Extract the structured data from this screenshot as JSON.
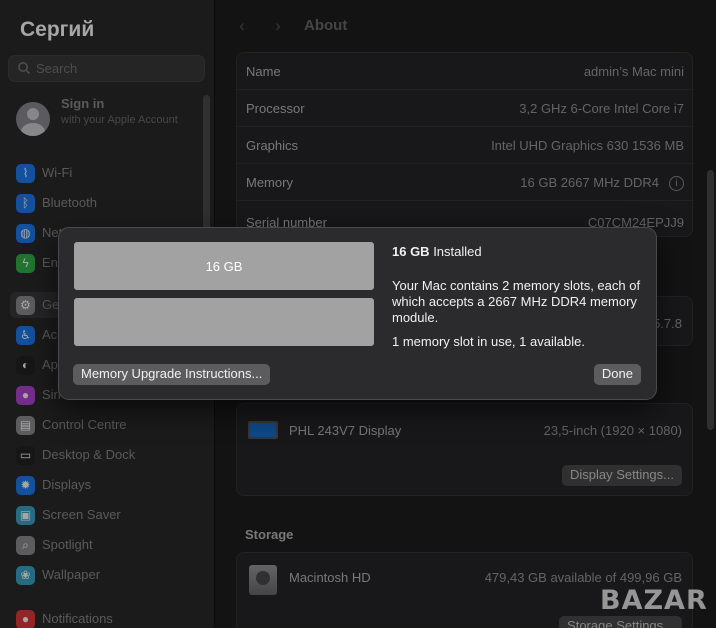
{
  "sidebar": {
    "user_title": "Сергий",
    "search_placeholder": "Search",
    "signin": {
      "name": "Sign in",
      "sub": "with your Apple Account"
    },
    "items": [
      {
        "label": "Wi-Fi",
        "icon": "wifi-icon",
        "color": "#1e7cf2",
        "glyph": "⌇"
      },
      {
        "label": "Bluetooth",
        "icon": "bluetooth-icon",
        "color": "#1e7cf2",
        "glyph": "ᛒ"
      },
      {
        "label": "Network",
        "icon": "network-icon",
        "color": "#1e7cf2",
        "glyph": "◍"
      },
      {
        "label": "Energy",
        "icon": "energy-icon",
        "color": "#33b24a",
        "glyph": "ϟ"
      },
      {
        "label": "General",
        "icon": "gear-icon",
        "color": "#8e8e93",
        "glyph": "⚙"
      },
      {
        "label": "Accessibility",
        "icon": "accessibility-icon",
        "color": "#1e7cf2",
        "glyph": "♿"
      },
      {
        "label": "Appearance",
        "icon": "appearance-icon",
        "color": "#222",
        "glyph": "◐"
      },
      {
        "label": "Siri",
        "icon": "siri-icon",
        "color": "#b446d6",
        "glyph": "●"
      },
      {
        "label": "Control Centre",
        "icon": "control-centre-icon",
        "color": "#8e8e93",
        "glyph": "▤"
      },
      {
        "label": "Desktop & Dock",
        "icon": "dock-icon",
        "color": "#222",
        "glyph": "▭"
      },
      {
        "label": "Displays",
        "icon": "displays-icon",
        "color": "#1e7cf2",
        "glyph": "✹"
      },
      {
        "label": "Screen Saver",
        "icon": "screen-saver-icon",
        "color": "#3aa6c9",
        "glyph": "▣"
      },
      {
        "label": "Spotlight",
        "icon": "spotlight-icon",
        "color": "#8e8e93",
        "glyph": "⌕"
      },
      {
        "label": "Wallpaper",
        "icon": "wallpaper-icon",
        "color": "#3aa6c9",
        "glyph": "❀"
      },
      {
        "label": "Notifications",
        "icon": "notifications-icon",
        "color": "#e5383b",
        "glyph": "●"
      }
    ]
  },
  "toolbar": {
    "title": "About",
    "back_glyph": "‹",
    "forward_glyph": "›"
  },
  "about": {
    "rows": [
      {
        "key": "Name",
        "value": "admin’s Mac mini"
      },
      {
        "key": "Processor",
        "value": "3,2 GHz 6-Core Intel Core i7"
      },
      {
        "key": "Graphics",
        "value": "Intel UHD Graphics 630 1536 MB"
      },
      {
        "key": "Memory",
        "value": "16 GB 2667 MHz DDR4"
      },
      {
        "key": "Serial number",
        "value": "C07CM24EPJJ9"
      }
    ],
    "macos_partial_version": "5.7.8"
  },
  "displays": {
    "name": "PHL 243V7 Display",
    "size": "23,5-inch (1920 × 1080)",
    "settings_button": "Display Settings..."
  },
  "storage": {
    "title": "Storage",
    "disk_name": "Macintosh HD",
    "available": "479,43 GB available of 499,96 GB",
    "settings_button": "Storage Settings..."
  },
  "sheet": {
    "headline_bold": "16 GB",
    "headline_rest": " Installed",
    "slot1_label": "16 GB",
    "slot2_label": "",
    "description": "Your Mac contains 2 memory slots, each of which accepts a 2667 MHz DDR4 memory module.",
    "usage": "1 memory slot in use, 1 available.",
    "instructions_button": "Memory Upgrade Instructions...",
    "done_button": "Done"
  },
  "watermark": "BAZAR"
}
